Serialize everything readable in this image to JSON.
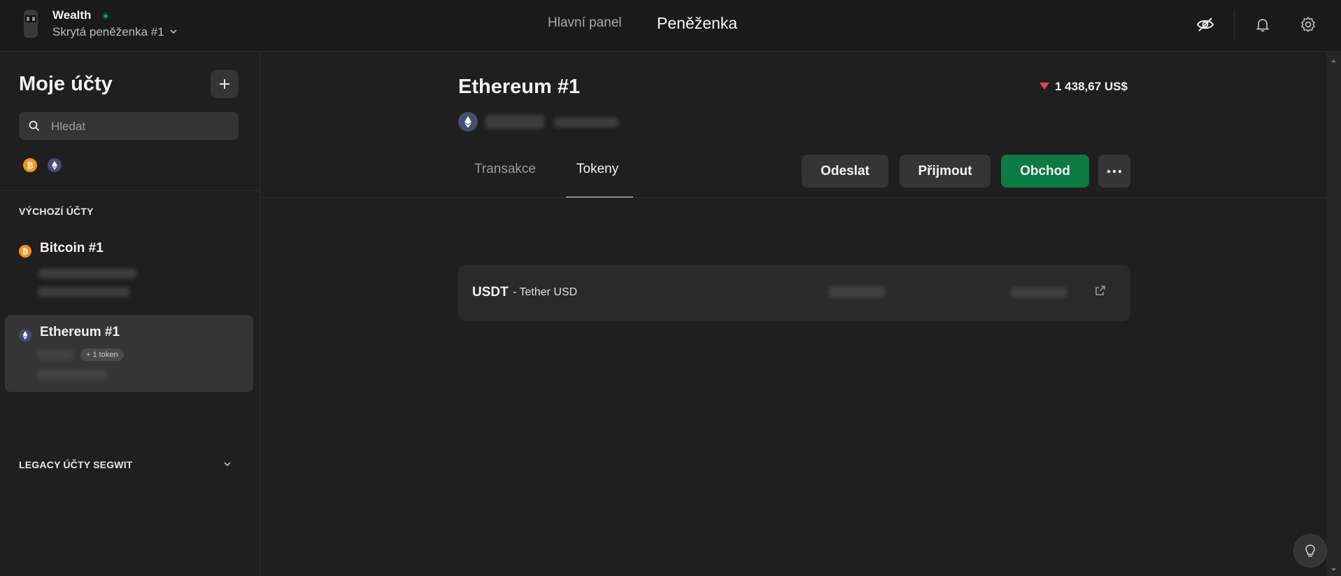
{
  "header": {
    "wallet_name": "Wealth",
    "wallet_subtitle": "Skrytá peněženka #1",
    "nav": {
      "dashboard": "Hlavní panel",
      "wallet": "Peněženka"
    }
  },
  "sidebar": {
    "title": "Moje účty",
    "search_placeholder": "Hledat",
    "section_default": "VÝCHOZÍ ÚČTY",
    "section_legacy": "LEGACY ÚČTY SEGWIT",
    "accounts": [
      {
        "name": "Bitcoin #1",
        "coin": "bitcoin-icon"
      },
      {
        "name": "Ethereum #1",
        "coin": "ethereum-icon",
        "token_badge": "+ 1 token"
      }
    ]
  },
  "main": {
    "account_title": "Ethereum #1",
    "fiat_change": "1 438,67 US$",
    "tabs": [
      {
        "label": "Transakce",
        "active": false
      },
      {
        "label": "Tokeny",
        "active": true
      }
    ],
    "actions": {
      "send": "Odeslat",
      "receive": "Přijmout",
      "trade": "Obchod"
    },
    "tokens": [
      {
        "symbol": "USDT",
        "name": "- Tether USD"
      }
    ]
  },
  "colors": {
    "background": "#1f1f1f",
    "panel": "#353535",
    "accent_green": "#0c7a43",
    "negative_red": "#e0474c",
    "bitcoin_orange": "#f7931a",
    "ethereum_indigo": "#454a75"
  }
}
